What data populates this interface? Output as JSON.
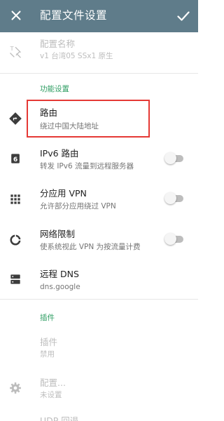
{
  "app_bar": {
    "title": "配置文件设置",
    "close_icon": "close-icon",
    "save_icon": "check-icon",
    "color": "#5f7c8a"
  },
  "profile": {
    "name_label": "配置名称",
    "name_value": "v1 台湾05 SSx1 原生",
    "icon": "rename-icon"
  },
  "function_section": {
    "header": "功能设置",
    "header_color": "#2f9e63",
    "items": [
      {
        "label": "路由",
        "sub": "绕过中国大陆地址",
        "icon": "route-icon",
        "highlighted": true
      },
      {
        "label": "IPv6 路由",
        "sub": "转发 IPv6 流量到远程服务器",
        "icon": "ipv6-icon",
        "toggle": false
      },
      {
        "label": "分应用 VPN",
        "sub": "允许部分应用绕过 VPN",
        "icon": "apps-grid-icon",
        "toggle": false
      },
      {
        "label": "网络限制",
        "sub": "使系统视此 VPN 为按流量计费",
        "icon": "data-usage-icon",
        "toggle": false
      },
      {
        "label": "远程 DNS",
        "sub": "dns.google",
        "icon": "dns-icon"
      }
    ]
  },
  "plugin_section": {
    "header": "插件",
    "items": [
      {
        "label": "插件",
        "sub": "禁用"
      },
      {
        "label": "配置...",
        "sub": "未设置",
        "icon": "settings-icon"
      }
    ],
    "partial_label": "UDP 回退"
  },
  "highlight_color": "#e53935"
}
